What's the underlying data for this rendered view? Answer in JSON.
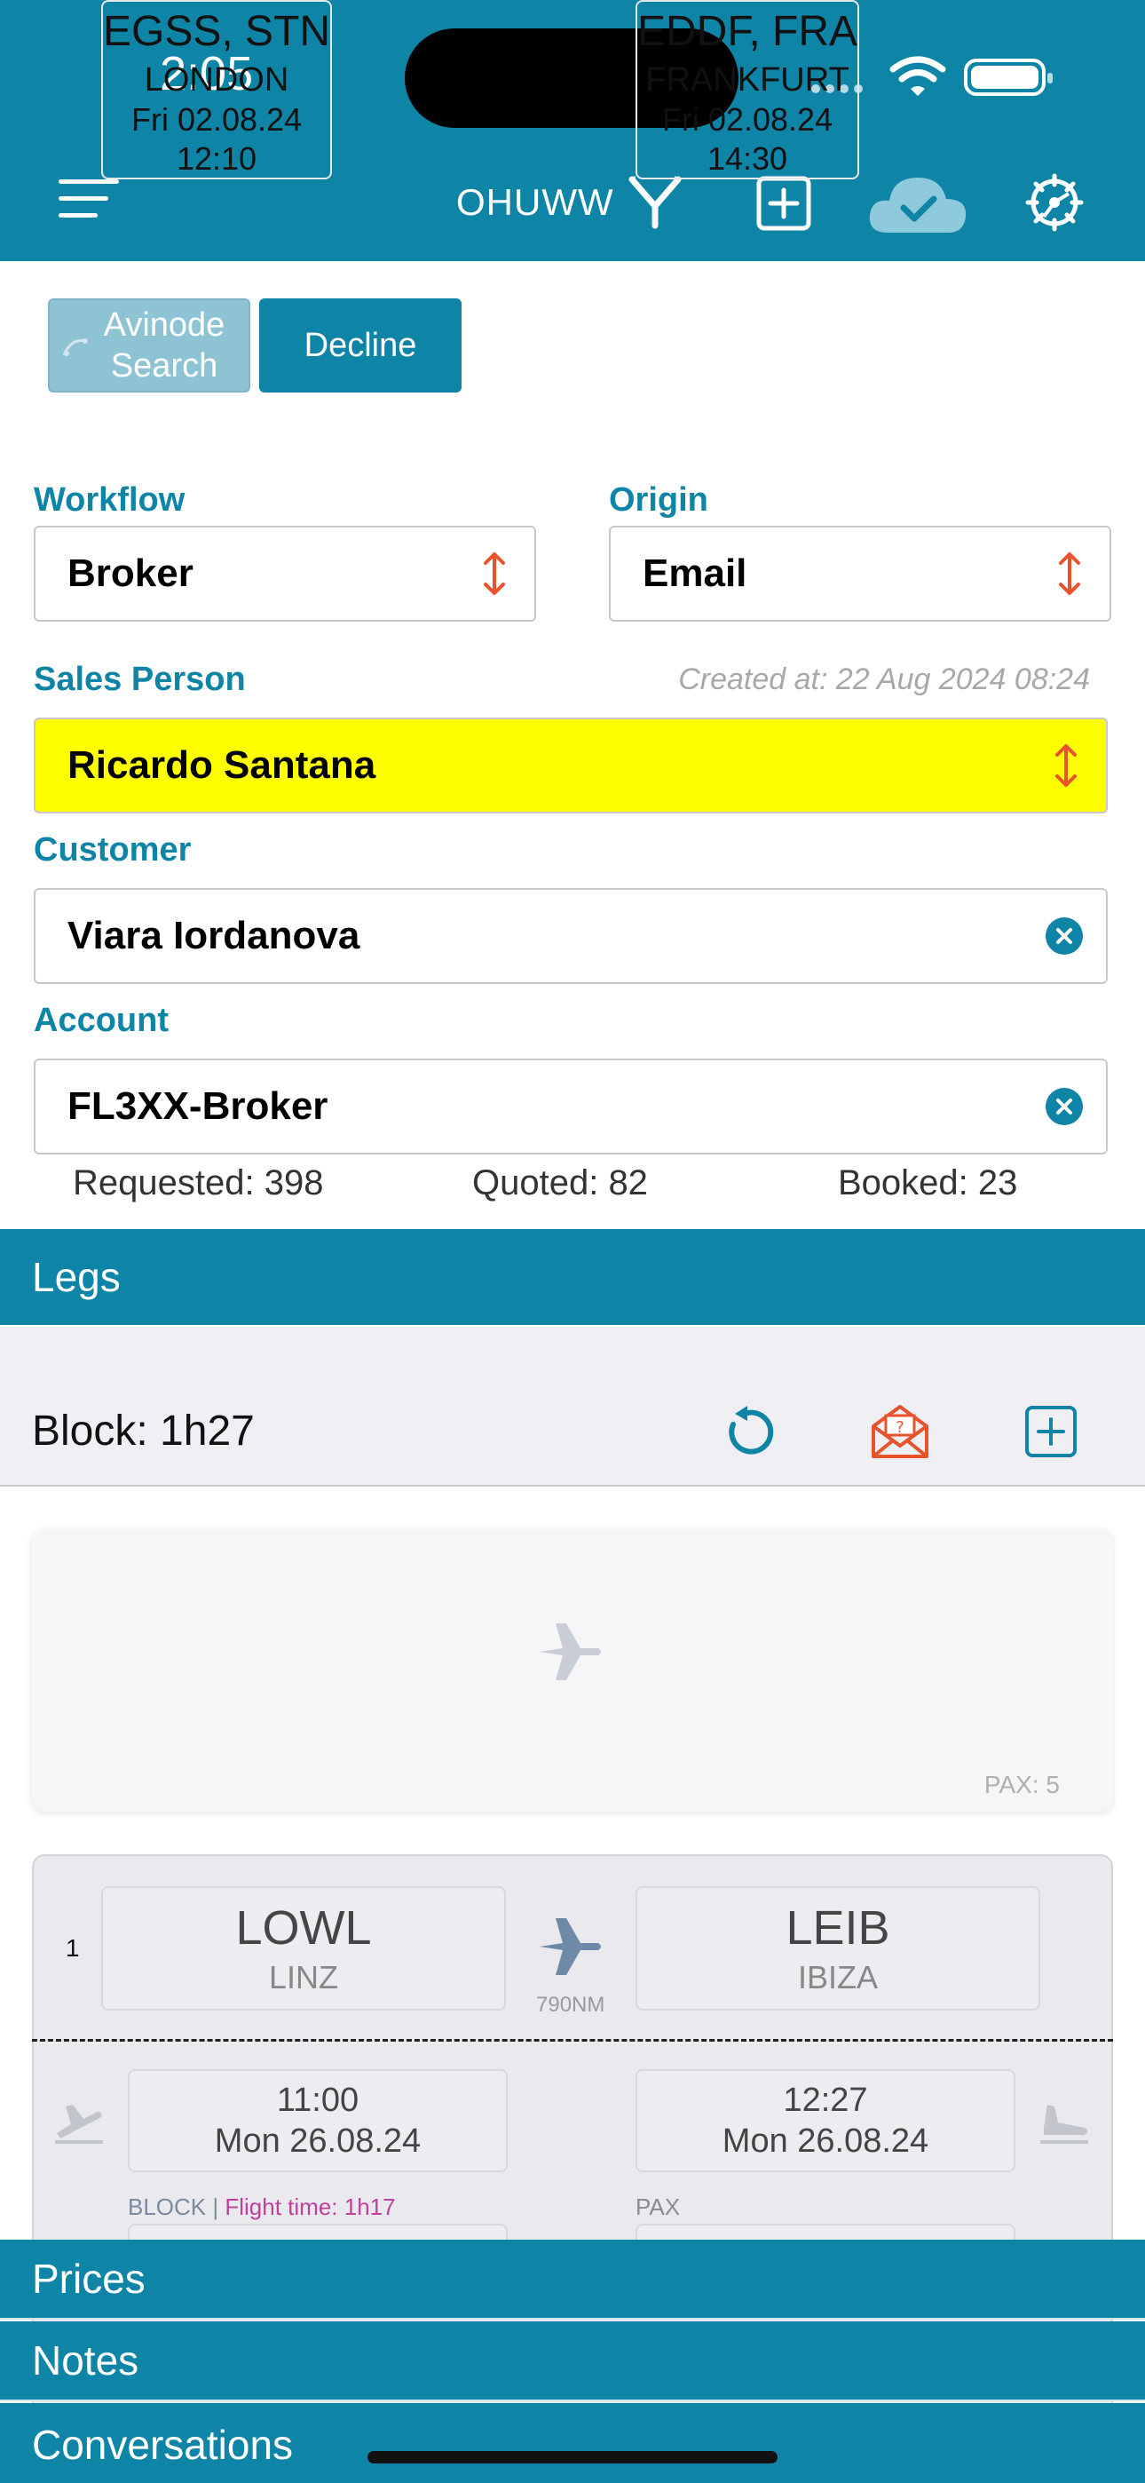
{
  "status_bar": {
    "time": "2:05"
  },
  "header": {
    "tail_number": "OHUWW",
    "icons": [
      "menu-icon",
      "fork-icon",
      "plus-icon",
      "cloud-check-icon",
      "gear-icon"
    ]
  },
  "actions": {
    "avinode": "Avinode Search",
    "decline": "Decline"
  },
  "form": {
    "workflow_label": "Workflow",
    "workflow_value": "Broker",
    "origin_label": "Origin",
    "origin_value": "Email",
    "sales_label": "Sales Person",
    "created": "Created at: 22 Aug 2024 08:24",
    "sales_value": "Ricardo Santana",
    "customer_label": "Customer",
    "customer_value": "Viara Iordanova",
    "account_label": "Account",
    "account_value": "FL3XX-Broker"
  },
  "stats": {
    "requested": "Requested: 398",
    "quoted": "Quoted: 82",
    "booked": "Booked: 23"
  },
  "legs": {
    "title": "Legs",
    "block": "Block: 1h27",
    "leg0": {
      "from_code": "EGSS, STN",
      "from_city": "LONDON",
      "from_date": "Fri 02.08.24",
      "from_time": "12:10",
      "to_code": "EDDF, FRA",
      "to_city": "FRANKFURT",
      "to_date": "Fri 02.08.24",
      "to_time": "14:30",
      "pax": "PAX: 5"
    },
    "leg1": {
      "number": "1",
      "from_code": "LOWL",
      "from_city": "LINZ",
      "to_code": "LEIB",
      "to_city": "IBIZA",
      "distance": "790NM",
      "dep_time": "11:00",
      "dep_date": "Mon 26.08.24",
      "arr_time": "12:27",
      "arr_date": "Mon 26.08.24",
      "block_label": "BLOCK",
      "flight_time": "Flight time: 1h17",
      "pax_label": "PAX"
    }
  },
  "sections": {
    "prices": "Prices",
    "notes": "Notes",
    "conversations": "Conversations"
  },
  "colors": {
    "primary": "#0e84a6",
    "highlight": "#ffff00",
    "accent": "#e8532b"
  }
}
